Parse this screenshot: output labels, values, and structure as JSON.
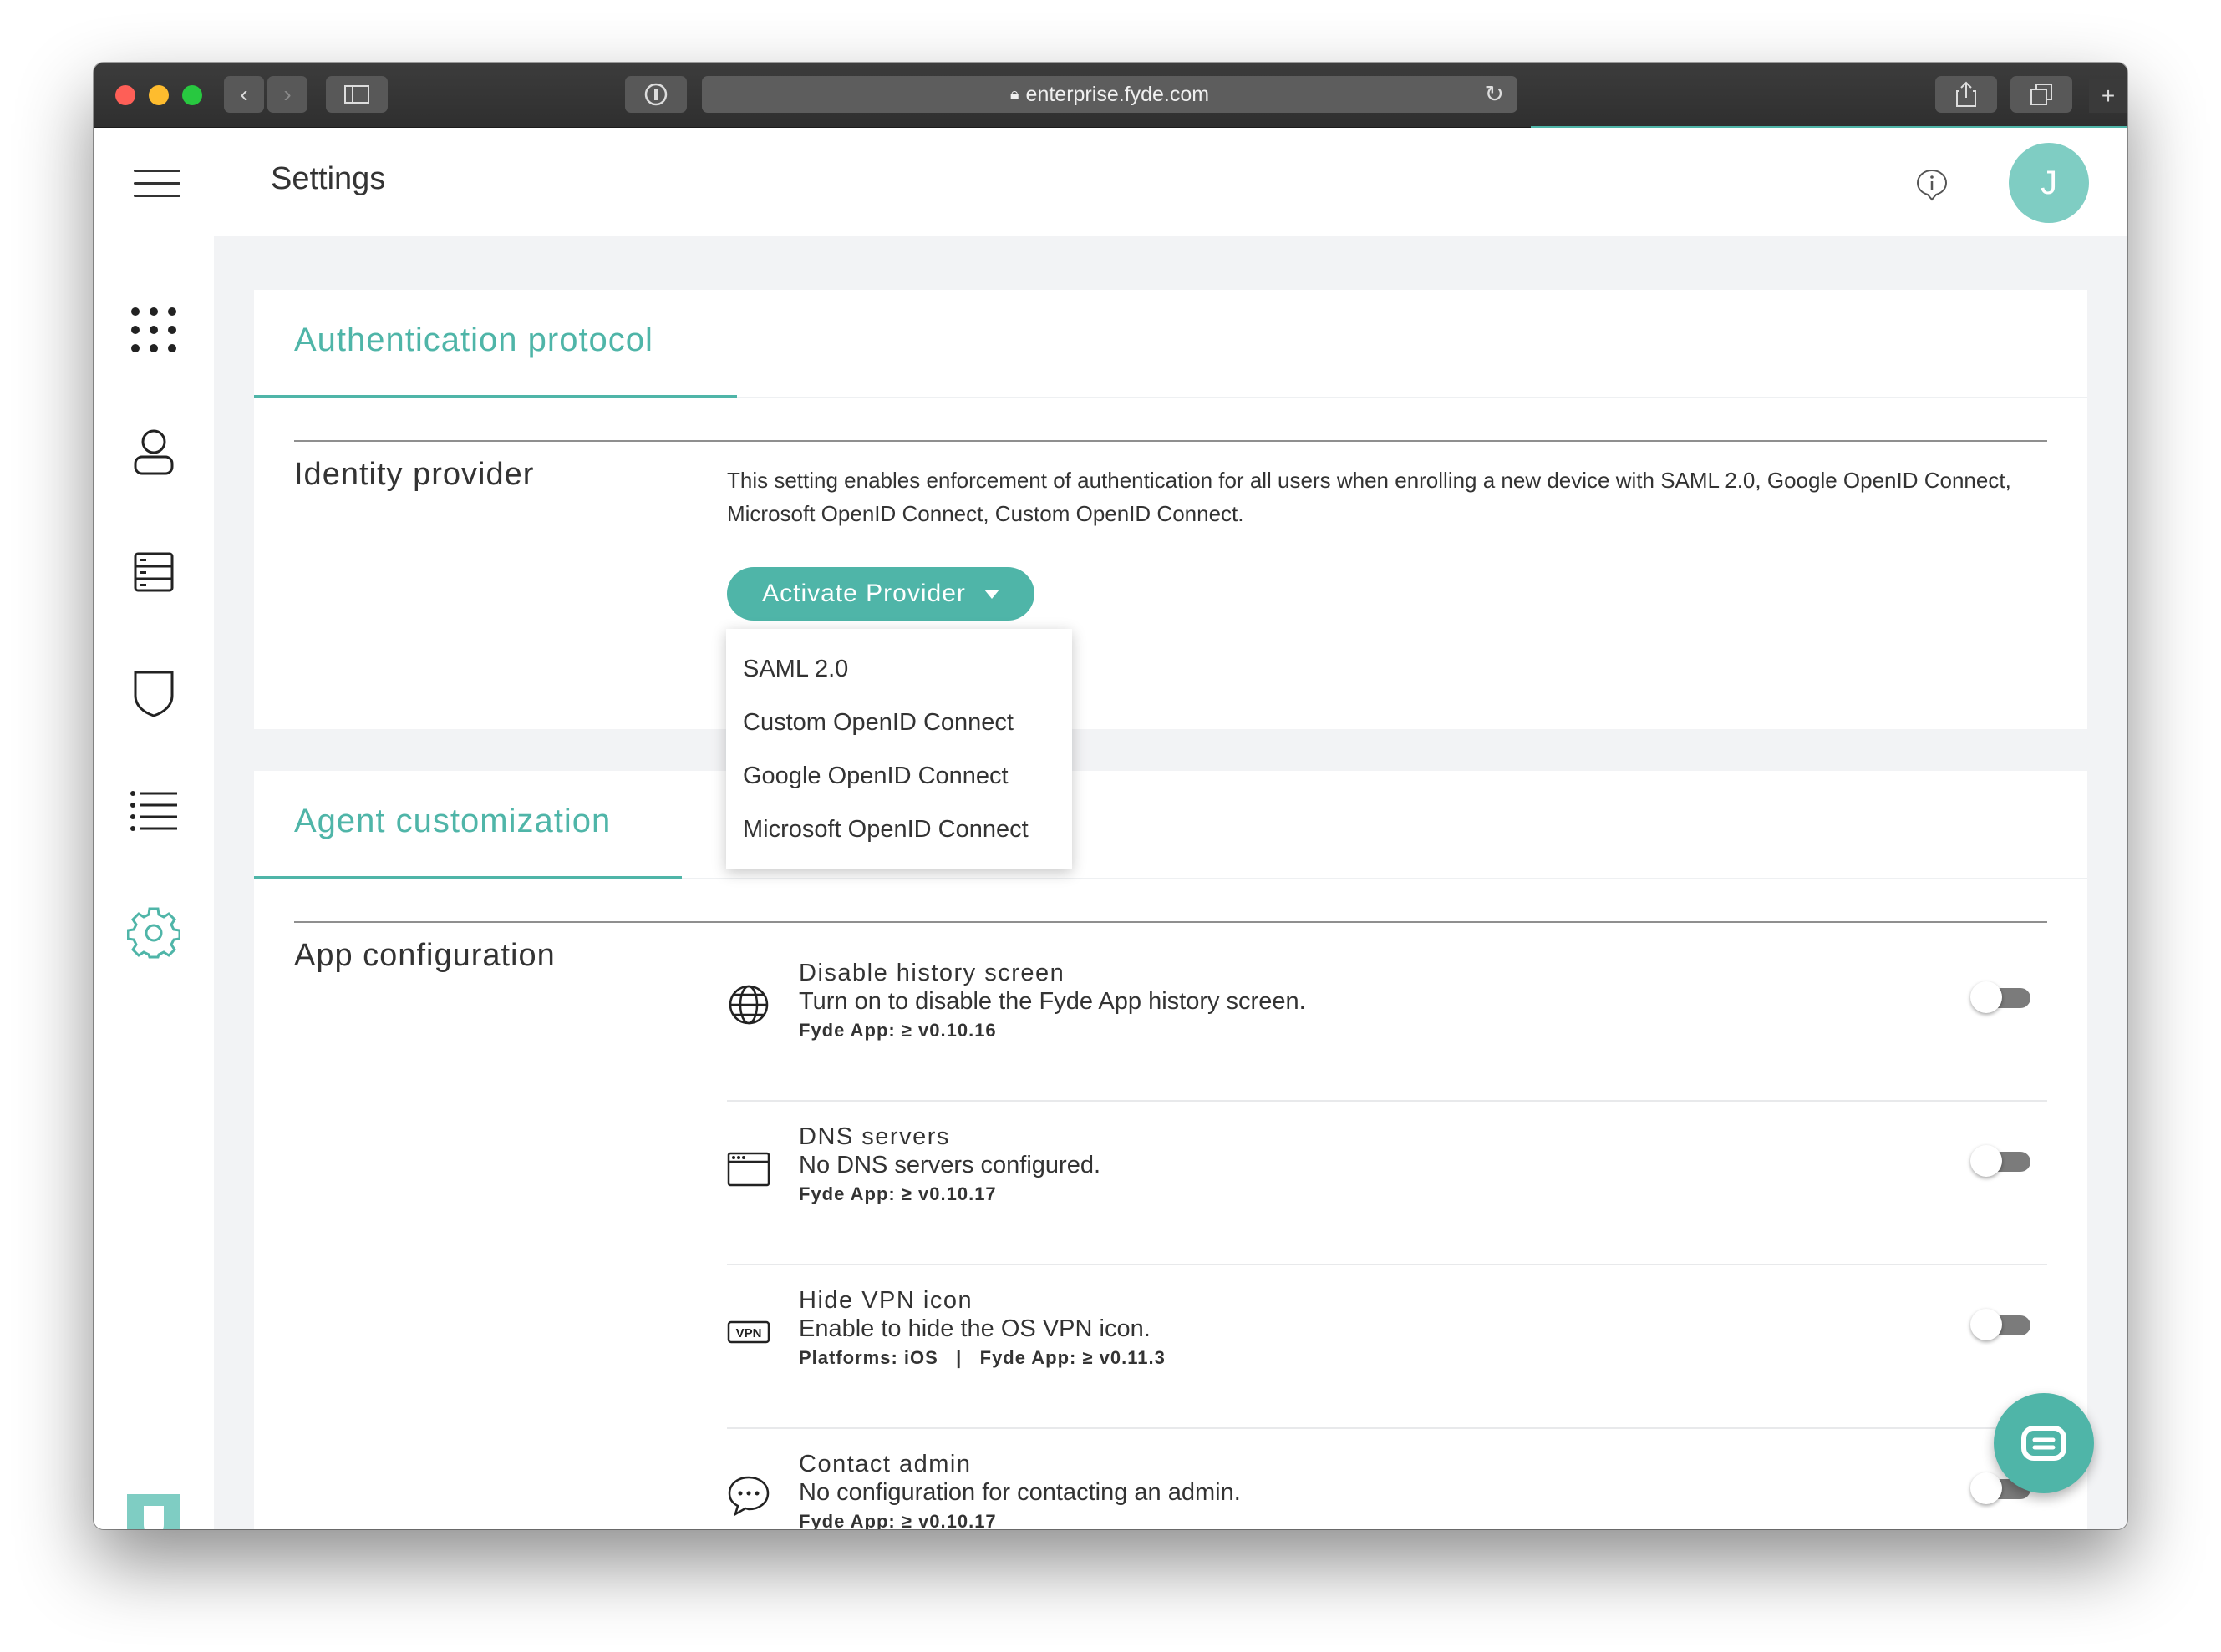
{
  "browser": {
    "url": "enterprise.fyde.com",
    "lock_icon": "lock-icon"
  },
  "header": {
    "title": "Settings",
    "avatar_initial": "J"
  },
  "sidebar": {
    "items": [
      {
        "name": "apps-grid-icon"
      },
      {
        "name": "user-icon"
      },
      {
        "name": "servers-icon"
      },
      {
        "name": "shield-icon"
      },
      {
        "name": "list-icon"
      },
      {
        "name": "settings-icon",
        "active": true
      }
    ]
  },
  "auth": {
    "tab_label": "Authentication protocol",
    "section_title": "Identity provider",
    "description": "This setting enables enforcement of authentication for all users when enrolling a new device with SAML 2.0, Google OpenID Connect, Microsoft OpenID Connect, Custom OpenID Connect.",
    "button_label": "Activate Provider",
    "dropdown_options": [
      "SAML 2.0",
      "Custom OpenID Connect",
      "Google OpenID Connect",
      "Microsoft OpenID Connect"
    ]
  },
  "agent": {
    "tab_label": "Agent customization",
    "section_title": "App configuration",
    "rows": [
      {
        "title": "Disable history screen",
        "description": "Turn on to disable the Fyde App history screen.",
        "meta": "Fyde App: ≥ v0.10.16",
        "enabled": false
      },
      {
        "title": "DNS servers",
        "description": "No DNS servers configured.",
        "meta": "Fyde App: ≥ v0.10.17",
        "enabled": false
      },
      {
        "title": "Hide VPN icon",
        "description": "Enable to hide the OS VPN icon.",
        "meta": "Platforms: iOS   |   Fyde App: ≥ v0.11.3",
        "enabled": false
      },
      {
        "title": "Contact admin",
        "description": "No configuration for contacting an admin.",
        "meta": "Fyde App: ≥ v0.10.17",
        "enabled": false
      }
    ]
  },
  "colors": {
    "accent": "#4fb5a8",
    "avatar": "#7fcdc3",
    "background": "#f2f3f5"
  }
}
